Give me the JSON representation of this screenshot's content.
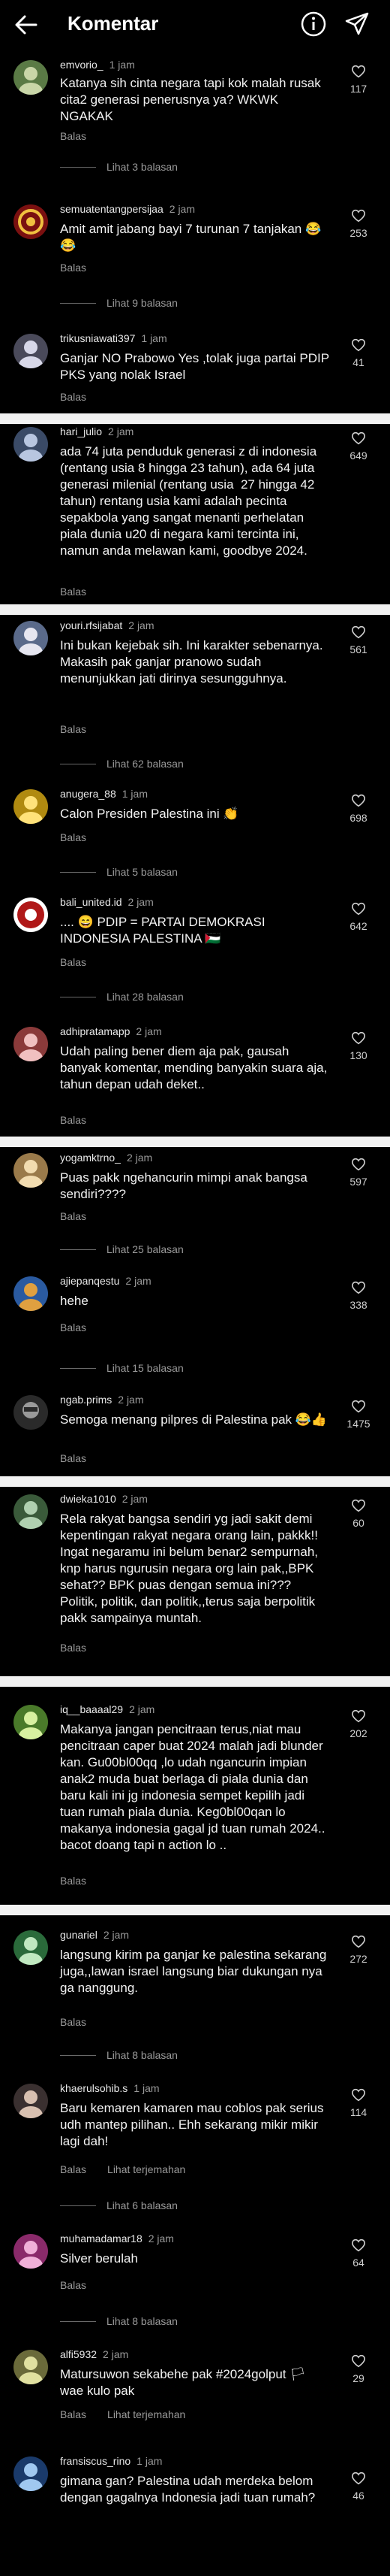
{
  "header": {
    "title": "Komentar"
  },
  "actions": {
    "reply": "Balas",
    "translate": "Lihat terjemahan"
  },
  "comments": [
    {
      "user": "emvorio_",
      "time": "1 jam",
      "text": "Katanya sih cinta negara tapi kok malah rusak cita2 generasi penerusnya ya? WKWK NGAKAK",
      "likes": "117",
      "replies": "Lihat 3 balasan",
      "avatar_bg": "#5a7a45",
      "avatar_fg": "#c9d6a8"
    },
    {
      "user": "semuatentangpersijaa",
      "time": "2 jam",
      "text": "Amit amit jabang bayi 7 turunan 7 tanjakan 😂😂",
      "likes": "253",
      "replies": "Lihat 9 balasan",
      "avatar_bg": "#7a1010",
      "avatar_fg": "#f0c040"
    },
    {
      "user": "trikusniawati397",
      "time": "1 jam",
      "text": "Ganjar NO Prabowo Yes ,tolak juga partai PDIP PKS yang nolak Israel",
      "likes": "41",
      "replies": "",
      "avatar_bg": "#4a4a5a",
      "avatar_fg": "#d8d8e8"
    },
    {
      "user": "hari_julio",
      "time": "2 jam",
      "text": "ada 74 juta penduduk generasi z di indonesia (rentang usia 8 hingga 23 tahun), ada 64 juta generasi milenial (rentang usia  27 hingga 42 tahun) rentang usia kami adalah pecinta sepakbola yang sangat menanti perhelatan piala dunia u20 di negara kami tercinta ini,  namun anda melawan kami, goodbye 2024.",
      "likes": "649",
      "replies": "",
      "avatar_bg": "#3a4a66",
      "avatar_fg": "#b8c6e0"
    },
    {
      "user": "youri.rfsijabat",
      "time": "2 jam",
      "text": "Ini bukan kejebak sih. Ini karakter sebenarnya. Makasih pak ganjar pranowo sudah menunjukkan jati dirinya sesungguhnya.",
      "likes": "561",
      "replies": "Lihat 62 balasan",
      "avatar_bg": "#5a6a8a",
      "avatar_fg": "#e6e6f0"
    },
    {
      "user": "anugera_88",
      "time": "1 jam",
      "text": "Calon Presiden Palestina ini 👏",
      "likes": "698",
      "replies": "Lihat 5 balasan",
      "avatar_bg": "#b08a10",
      "avatar_fg": "#ffe27a"
    },
    {
      "user": "bali_united.id",
      "time": "2 jam",
      "text": ".... 😄 PDIP = PARTAI DEMOKRASI INDONESIA PALESTINA 🇵🇸",
      "likes": "642",
      "replies": "Lihat 28 balasan",
      "avatar_bg": "#b01818",
      "avatar_fg": "#ffffff"
    },
    {
      "user": "adhipratamapp",
      "time": "2 jam",
      "text": "Udah paling bener diem aja pak, gausah banyak komentar, mending banyakin suara aja, tahun depan udah deket..",
      "likes": "130",
      "replies": "",
      "avatar_bg": "#8a3a3a",
      "avatar_fg": "#f0c0c0"
    },
    {
      "user": "yogamktrno_",
      "time": "2 jam",
      "text": "Puas pakk ngehancurin mimpi anak bangsa sendiri????",
      "likes": "597",
      "replies": "Lihat 25 balasan",
      "avatar_bg": "#9a7a4a",
      "avatar_fg": "#f2dcb0"
    },
    {
      "user": "ajiepanqestu",
      "time": "2 jam",
      "text": "hehe",
      "likes": "338",
      "replies": "Lihat 15 balasan",
      "avatar_bg": "#2a5aa0",
      "avatar_fg": "#e0a040"
    },
    {
      "user": "ngab.prims",
      "time": "2 jam",
      "text": "Semoga menang pilpres di Palestina pak 😂👍",
      "likes": "1475",
      "replies": "",
      "avatar_bg": "#2a2a2a",
      "avatar_fg": "#9a9a9a"
    },
    {
      "user": "dwieka1010",
      "time": "2 jam",
      "text": "Rela rakyat bangsa sendiri yg jadi sakit demi kepentingan rakyat negara orang lain, pakkk!! Ingat negaramu ini belum benar2 sempurnah, knp harus ngurusin negara org lain pak,,BPK sehat?? BPK puas dengan semua ini??? Politik, politik, dan politik,,terus saja berpolitik pakk sampainya muntah.",
      "likes": "60",
      "replies": "",
      "avatar_bg": "#3a5a3a",
      "avatar_fg": "#b0d0b0"
    },
    {
      "user": "iq__baaaal29",
      "time": "2 jam",
      "text": "Makanya jangan pencitraan terus,niat mau pencitraan caper buat 2024 malah jadi blunder kan. Gu00bl00qq ,lo udah ngancurin impian anak2 muda buat berlaga di piala dunia dan baru kali ini jg indonesia sempet kepilih jadi tuan rumah piala dunia. Keg0bl00qan lo makanya indonesia gagal jd tuan rumah 2024.. bacot doang tapi n action lo ..",
      "likes": "202",
      "replies": "",
      "avatar_bg": "#4a7a2a",
      "avatar_fg": "#d8f0a0"
    },
    {
      "user": "gunariel",
      "time": "2 jam",
      "text": "langsung kirim pa ganjar ke palestina sekarang juga,,lawan israel langsung biar dukungan nya ga nanggung.",
      "likes": "272",
      "replies": "Lihat 8 balasan",
      "avatar_bg": "#2a6a3a",
      "avatar_fg": "#c0e8c0"
    },
    {
      "user": "khaerulsohib.s",
      "time": "1 jam",
      "text": "Baru kemaren kamaren mau coblos pak serius udh mantep pilihan.. Ehh sekarang mikir mikir lagi dah!",
      "likes": "114",
      "replies": "Lihat 6 balasan",
      "translate": true,
      "avatar_bg": "#3a3030",
      "avatar_fg": "#d8c0b0"
    },
    {
      "user": "muhamadamar18",
      "time": "2 jam",
      "text": "Silver berulah",
      "likes": "64",
      "replies": "Lihat 8 balasan",
      "avatar_bg": "#8a2a6a",
      "avatar_fg": "#f0b0d8"
    },
    {
      "user": "alfi5932",
      "time": "2 jam",
      "text": "Matursuwon sekabehe pak #2024golput 🏳 wae kulo pak",
      "likes": "29",
      "replies": "",
      "translate": true,
      "avatar_bg": "#6a6a3a",
      "avatar_fg": "#e0e0a0"
    },
    {
      "user": "fransiscus_rino",
      "time": "1 jam",
      "text": "gimana gan? Palestina udah merdeka belom dengan gagalnya Indonesia jadi tuan rumah?",
      "likes": "46",
      "replies": "",
      "avatar_bg": "#1a3a6a",
      "avatar_fg": "#a0c8f0"
    }
  ]
}
